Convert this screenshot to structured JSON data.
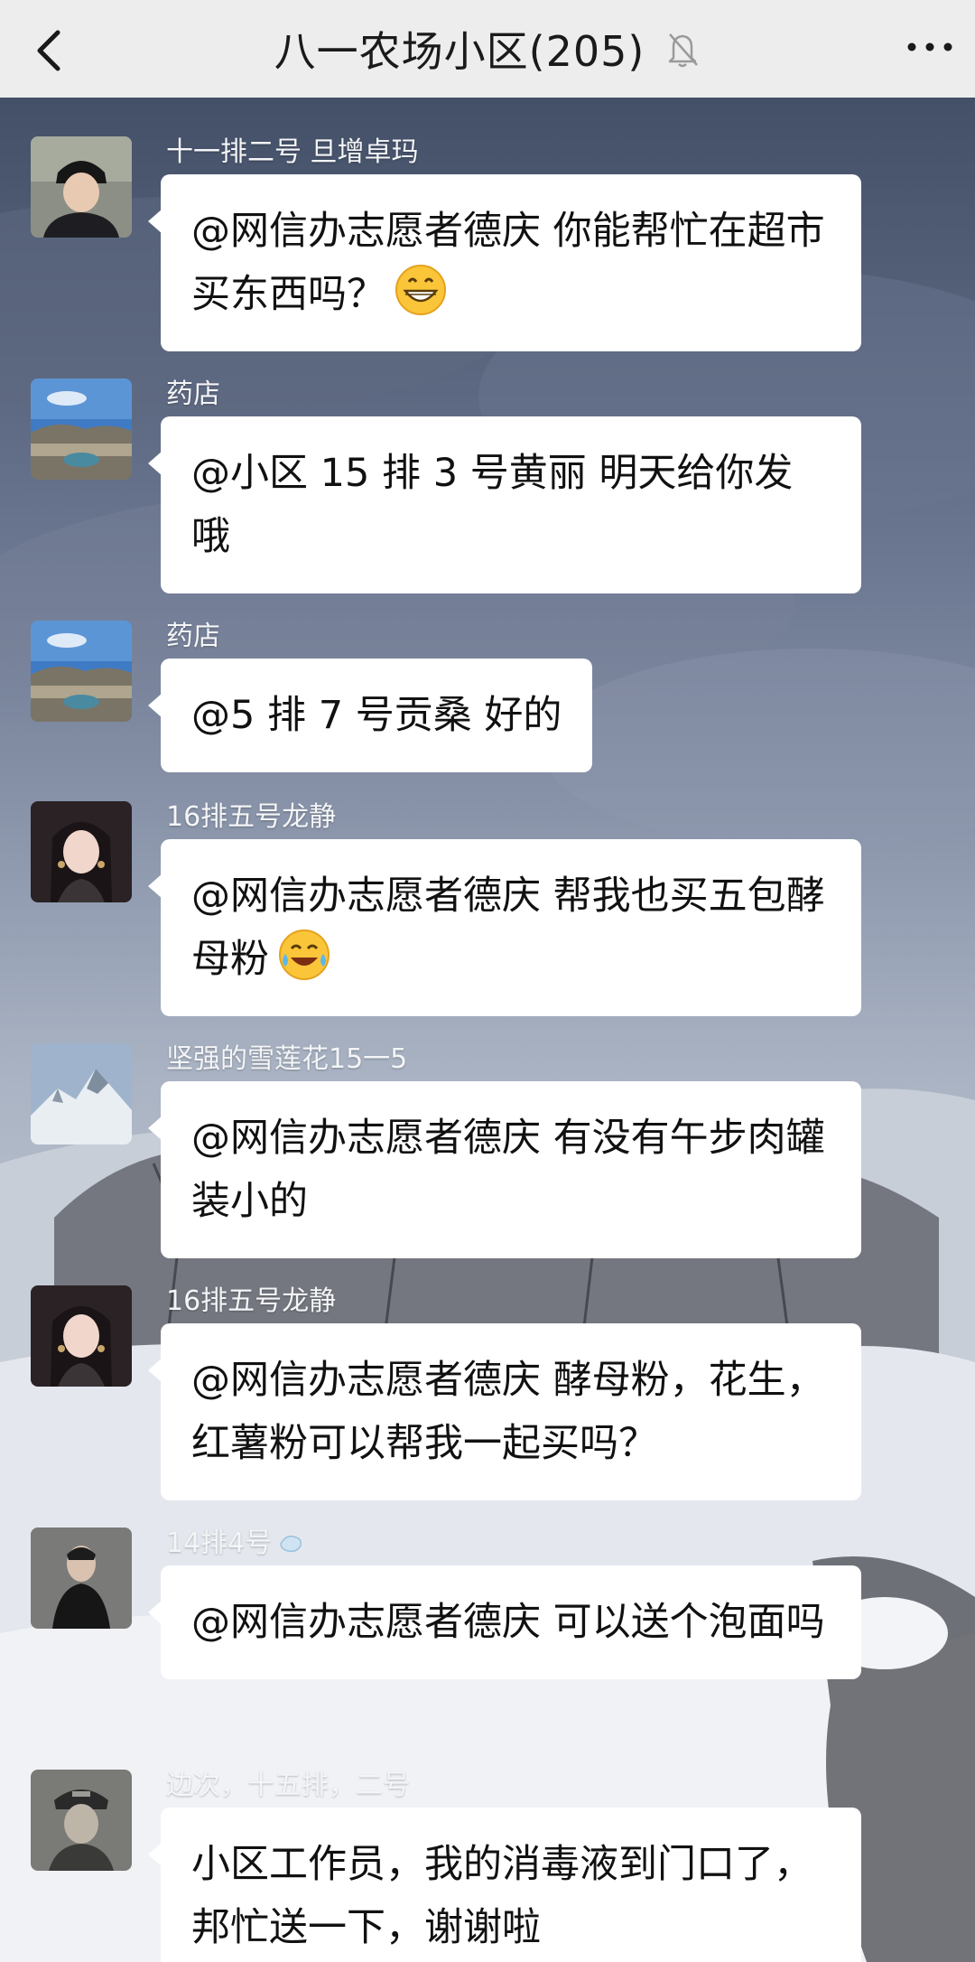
{
  "header": {
    "title": "八一农场小区(205)",
    "back_icon": "chevron-left-icon",
    "mute_icon": "bell-slash-icon",
    "more_icon": "more-dots-icon"
  },
  "messages": [
    {
      "sender": "十一排二号 旦增卓玛",
      "text": "@网信办志愿者德庆 你能帮忙在超市买东西吗？",
      "emoji": "grinning-emoji"
    },
    {
      "sender": "药店",
      "text": "@小区 15 排 3 号黄丽 明天给你发哦"
    },
    {
      "sender": "药店",
      "text": "@5 排 7 号贡桑 好的"
    },
    {
      "sender": "16排五号龙静",
      "text": "@网信办志愿者德庆 帮我也买五包酵母粉",
      "emoji": "tears-of-joy-emoji"
    },
    {
      "sender": "坚强的雪莲花15一5",
      "text": "@网信办志愿者德庆 有没有午步肉罐装小的"
    },
    {
      "sender": "16排五号龙静",
      "text": "@网信办志愿者德庆 酵母粉，花生，红薯粉可以帮我一起买吗？"
    },
    {
      "sender": "14排4号",
      "text": "@网信办志愿者德庆 可以送个泡面吗",
      "sender_icon": "droplet-icon"
    },
    {
      "sender": "边次，十五排，二号",
      "text": "小区工作员，我的消毒液到门口了，邦忙送一下，谢谢啦"
    }
  ],
  "colors": {
    "header_bg": "#ededed",
    "bubble_bg": "#ffffff",
    "sender_text": "#f4f5f7"
  }
}
